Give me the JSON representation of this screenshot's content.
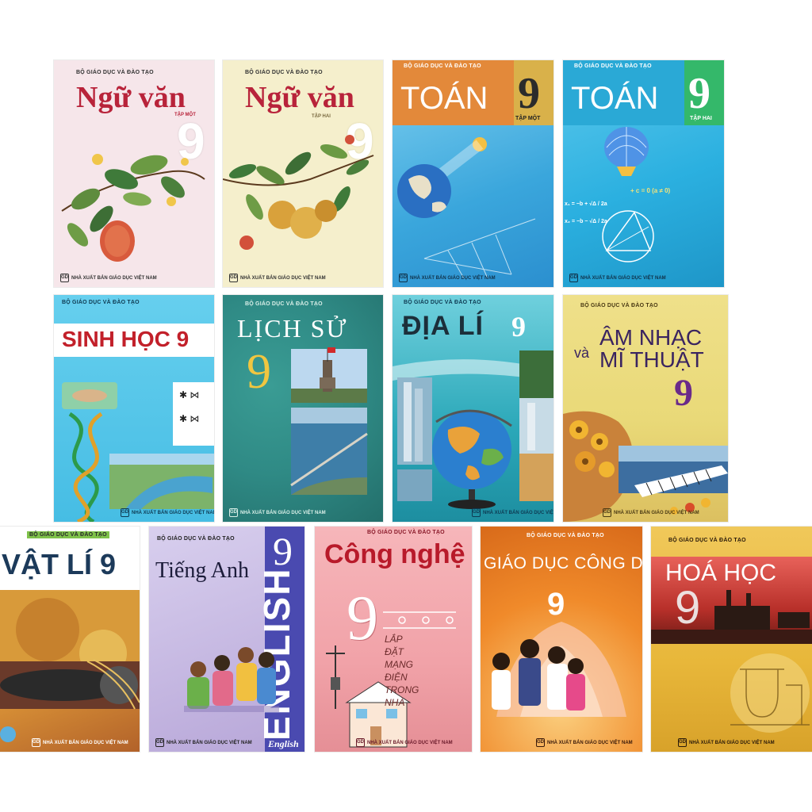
{
  "publisher_top": "BỘ GIÁO DỤC VÀ ĐÀO TẠO",
  "publisher_bottom": "NHÀ XUẤT BẢN GIÁO DỤC VIỆT NAM",
  "logo_text": "GD",
  "grade": "9",
  "books": {
    "ngu_van_1": {
      "title": "Ngữ văn",
      "volume": "TẬP MỘT",
      "color": "#f6e6ea"
    },
    "ngu_van_2": {
      "title": "Ngữ văn",
      "volume": "TẬP HAI",
      "color": "#f5efcc"
    },
    "toan_1": {
      "title": "TOÁN",
      "volume": "TẬP MỘT",
      "color": "#3aa6dc"
    },
    "toan_2": {
      "title": "TOÁN",
      "volume": "TẬP HAI",
      "color": "#2bb0e0",
      "formula_1": "x₁ = −b + √Δ / 2a",
      "formula_2": "x₂ = −b − √Δ / 2a",
      "formula_top": "+ c = 0 (a ≠ 0)"
    },
    "sinh_hoc": {
      "title": "SINH HỌC 9",
      "color": "#4fc3e6"
    },
    "lich_su": {
      "title": "LỊCH SỬ",
      "color": "#2f8a85"
    },
    "dia_li": {
      "title": "ĐỊA LÍ",
      "color": "#2aa7b8"
    },
    "am_nhac": {
      "title_line1": "ÂM NHẠC",
      "title_and": "và",
      "title_line2": "MĨ THUẬT",
      "color": "#e9d978"
    },
    "vat_li": {
      "title": "VẬT LÍ 9",
      "color": "#e7a33b"
    },
    "tieng_anh": {
      "title": "Tiếng Anh",
      "spine": "ENGLISH",
      "spine_small": "English",
      "color": "#b7a6d8"
    },
    "cong_nghe": {
      "title": "Công nghệ",
      "subtitle": [
        "LẮP",
        "ĐẶT",
        "MẠNG",
        "ĐIỆN",
        "TRONG",
        "NHÀ"
      ],
      "color": "#f1a2a8"
    },
    "gdcd": {
      "title": "GIÁO DỤC CÔNG DÂN",
      "color": "#f08a2a"
    },
    "hoa_hoc": {
      "title": "HOÁ HỌC",
      "color": "#e8b73a"
    }
  }
}
